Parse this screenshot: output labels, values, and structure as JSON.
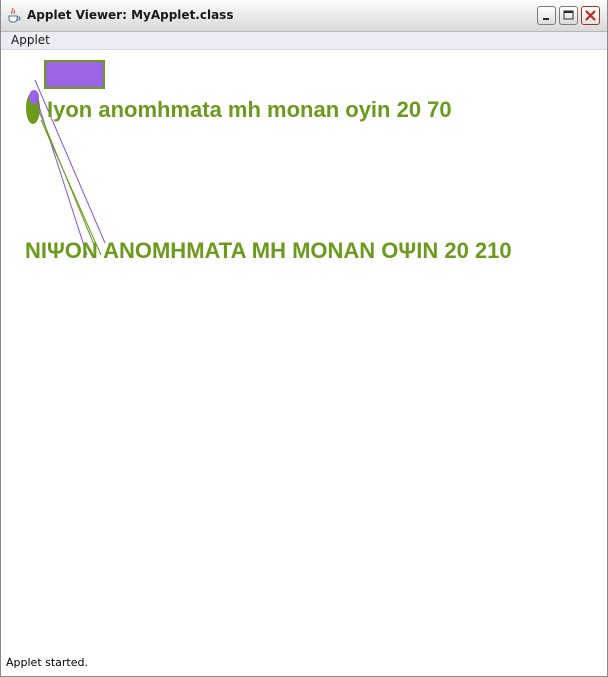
{
  "window": {
    "title": "Applet Viewer: MyApplet.class",
    "icon": "java-cup-icon",
    "controls": [
      "minimize-icon",
      "maximize-icon",
      "close-icon"
    ]
  },
  "menubar": {
    "items": [
      {
        "label": "Applet"
      }
    ]
  },
  "canvas": {
    "text_lower": "Iyon anomhmata mh monan oyin 20 70",
    "text_upper": "NIΨON ANOMHMATA MH MONAN OΨIN 20 210",
    "colors": {
      "text": "#6b9a1d",
      "rect_fill": "#9b63e6",
      "rect_border": "#6b9a1d",
      "oval_fill": "#6b9a1d",
      "oval_accent": "#9b63e6",
      "line_purple": "#8a52e0",
      "line_green": "#6b9a1d"
    }
  },
  "status": {
    "text": "Applet started."
  }
}
